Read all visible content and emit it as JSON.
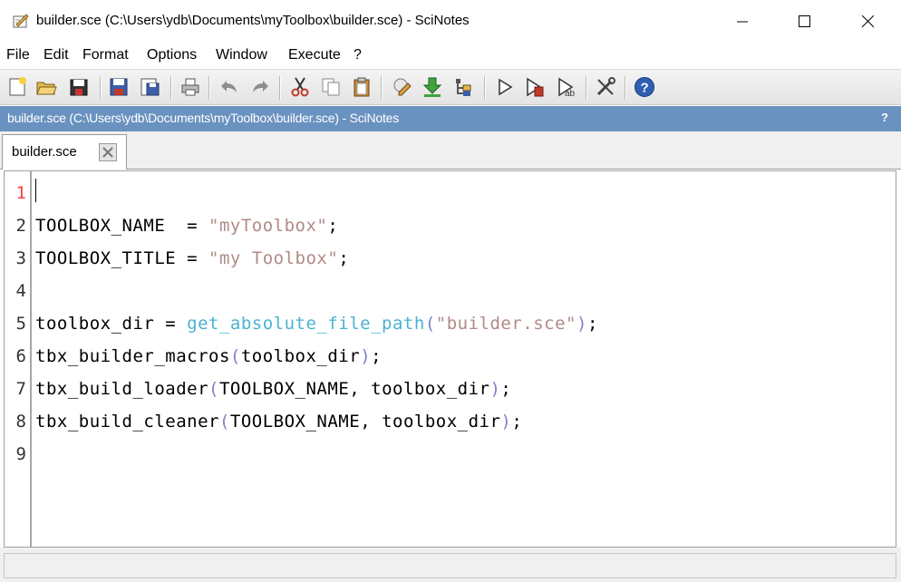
{
  "window": {
    "title": "builder.sce (C:\\Users\\ydb\\Documents\\myToolbox\\builder.sce) - SciNotes"
  },
  "menu": [
    "File",
    "Edit",
    "Format",
    "Options",
    "Window",
    "Execute",
    "?"
  ],
  "toolbar": {
    "icons": [
      "new-file-icon",
      "open-file-icon",
      "open-as-icon",
      "save-icon",
      "save-as-icon",
      "print-icon",
      "undo-icon",
      "redo-icon",
      "cut-icon",
      "copy-icon",
      "paste-icon",
      "edit-icon",
      "download-icon",
      "variable-browser-icon",
      "execute-icon",
      "execute-file-icon",
      "execute-until-icon",
      "preferences-icon",
      "help-icon"
    ]
  },
  "dock": {
    "title": "builder.sce (C:\\Users\\ydb\\Documents\\myToolbox\\builder.sce) - SciNotes",
    "help": "?"
  },
  "tab": {
    "label": "builder.sce"
  },
  "editor": {
    "current_line": 1,
    "line_numbers": [
      "1",
      "2",
      "3",
      "4",
      "5",
      "6",
      "7",
      "8",
      "9"
    ],
    "lines": [
      [],
      [
        {
          "t": "TOOLBOX_NAME  = ",
          "c": "id"
        },
        {
          "t": "\"myToolbox\"",
          "c": "str"
        },
        {
          "t": ";",
          "c": "id"
        }
      ],
      [
        {
          "t": "TOOLBOX_TITLE = ",
          "c": "id"
        },
        {
          "t": "\"my Toolbox\"",
          "c": "str"
        },
        {
          "t": ";",
          "c": "id"
        }
      ],
      [],
      [
        {
          "t": "toolbox_dir = ",
          "c": "id"
        },
        {
          "t": "get_absolute_file_path",
          "c": "fn"
        },
        {
          "t": "(",
          "c": "paren"
        },
        {
          "t": "\"builder.sce\"",
          "c": "str"
        },
        {
          "t": ")",
          "c": "paren"
        },
        {
          "t": ";",
          "c": "id"
        }
      ],
      [
        {
          "t": "tbx_builder_macros",
          "c": "id"
        },
        {
          "t": "(",
          "c": "paren"
        },
        {
          "t": "toolbox_dir",
          "c": "id"
        },
        {
          "t": ")",
          "c": "paren"
        },
        {
          "t": ";",
          "c": "id"
        }
      ],
      [
        {
          "t": "tbx_build_loader",
          "c": "id"
        },
        {
          "t": "(",
          "c": "paren"
        },
        {
          "t": "TOOLBOX_NAME, toolbox_dir",
          "c": "id"
        },
        {
          "t": ")",
          "c": "paren"
        },
        {
          "t": ";",
          "c": "id"
        }
      ],
      [
        {
          "t": "tbx_build_cleaner",
          "c": "id"
        },
        {
          "t": "(",
          "c": "paren"
        },
        {
          "t": "TOOLBOX_NAME, toolbox_dir",
          "c": "id"
        },
        {
          "t": ")",
          "c": "paren"
        },
        {
          "t": ";",
          "c": "id"
        }
      ],
      []
    ]
  },
  "colors": {
    "dock_title_bg": "#6a92c0",
    "string": "#b08a86",
    "function": "#4ab3d1",
    "paren": "#7b82c9",
    "current_line_number": "#ff3b3b"
  }
}
